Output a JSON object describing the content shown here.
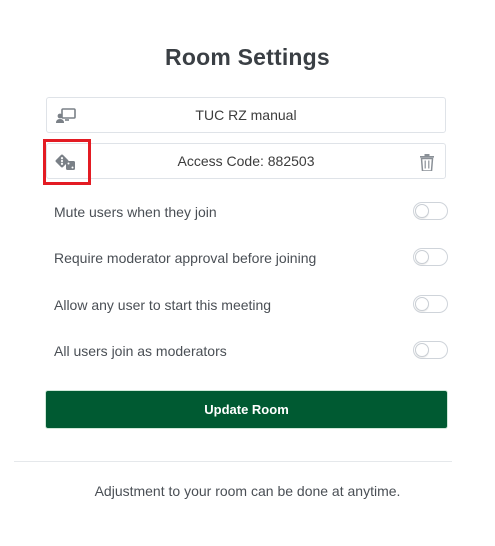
{
  "modal": {
    "title": "Room Settings",
    "room_name": {
      "value": "TUC RZ manual",
      "icon": "room-name-icon"
    },
    "access_code": {
      "value": "Access Code: 882503",
      "icon": "dice-icon",
      "action_icon": "trash-icon"
    },
    "settings": [
      {
        "label": "Mute users when they join",
        "enabled": false
      },
      {
        "label": "Require moderator approval before joining",
        "enabled": false
      },
      {
        "label": "Allow any user to start this meeting",
        "enabled": false
      },
      {
        "label": "All users join as moderators",
        "enabled": false
      }
    ],
    "update_button": "Update Room",
    "footer_note": "Adjustment to your room can be done at anytime."
  },
  "colors": {
    "primary_button": "#005a32",
    "highlight": "#e31b23",
    "border": "#dfe3e8"
  }
}
